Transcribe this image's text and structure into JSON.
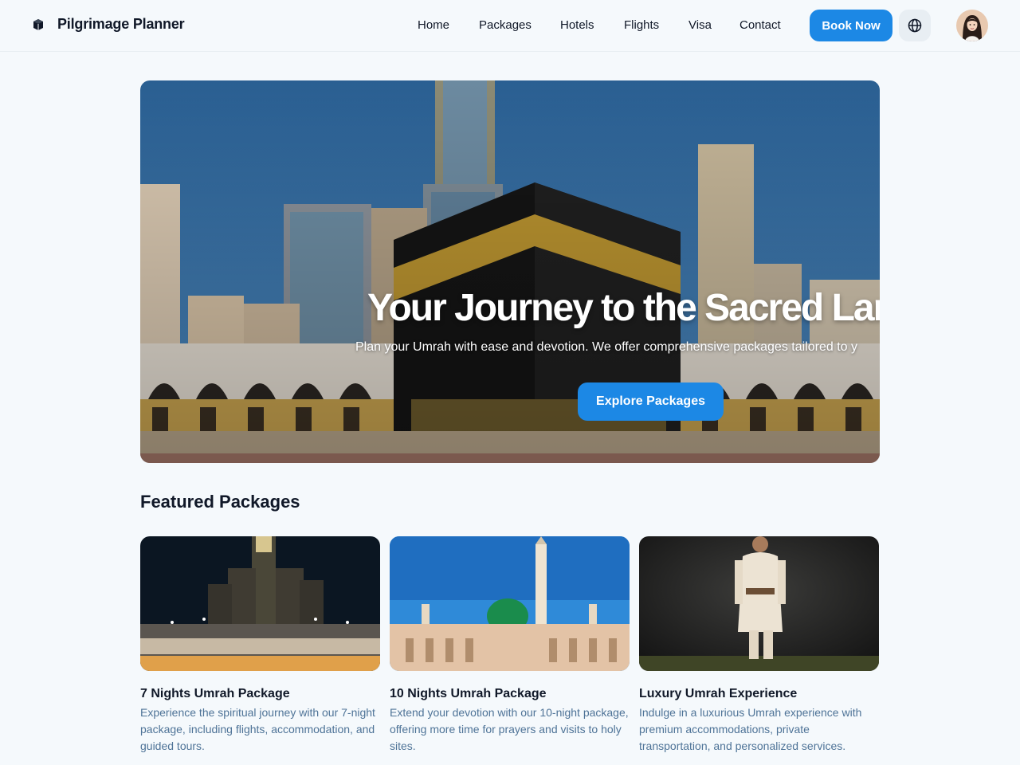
{
  "header": {
    "brand": "Pilgrimage Planner",
    "nav": [
      "Home",
      "Packages",
      "Hotels",
      "Flights",
      "Visa",
      "Contact"
    ],
    "book_label": "Book Now",
    "lang_icon": "globe-icon",
    "avatar_icon": "user-avatar"
  },
  "hero": {
    "title": "Your Journey to the Sacred Lan",
    "subtitle": "Plan your Umrah with ease and devotion. We offer comprehensive packages tailored to y",
    "cta_label": "Explore Packages"
  },
  "featured": {
    "title": "Featured Packages",
    "cards": [
      {
        "title": "7 Nights Umrah Package",
        "description": "Experience the spiritual journey with our 7-night package, including flights, accommodation, and guided tours."
      },
      {
        "title": "10 Nights Umrah Package",
        "description": "Extend your devotion with our 10-night package, offering more time for prayers and visits to holy sites."
      },
      {
        "title": "Luxury Umrah Experience",
        "description": "Indulge in a luxurious Umrah experience with premium accommodations, private transportation, and personalized services."
      }
    ]
  },
  "colors": {
    "accent": "#1c88e5",
    "background": "#f5f9fc",
    "muted_text": "#4e7397"
  }
}
